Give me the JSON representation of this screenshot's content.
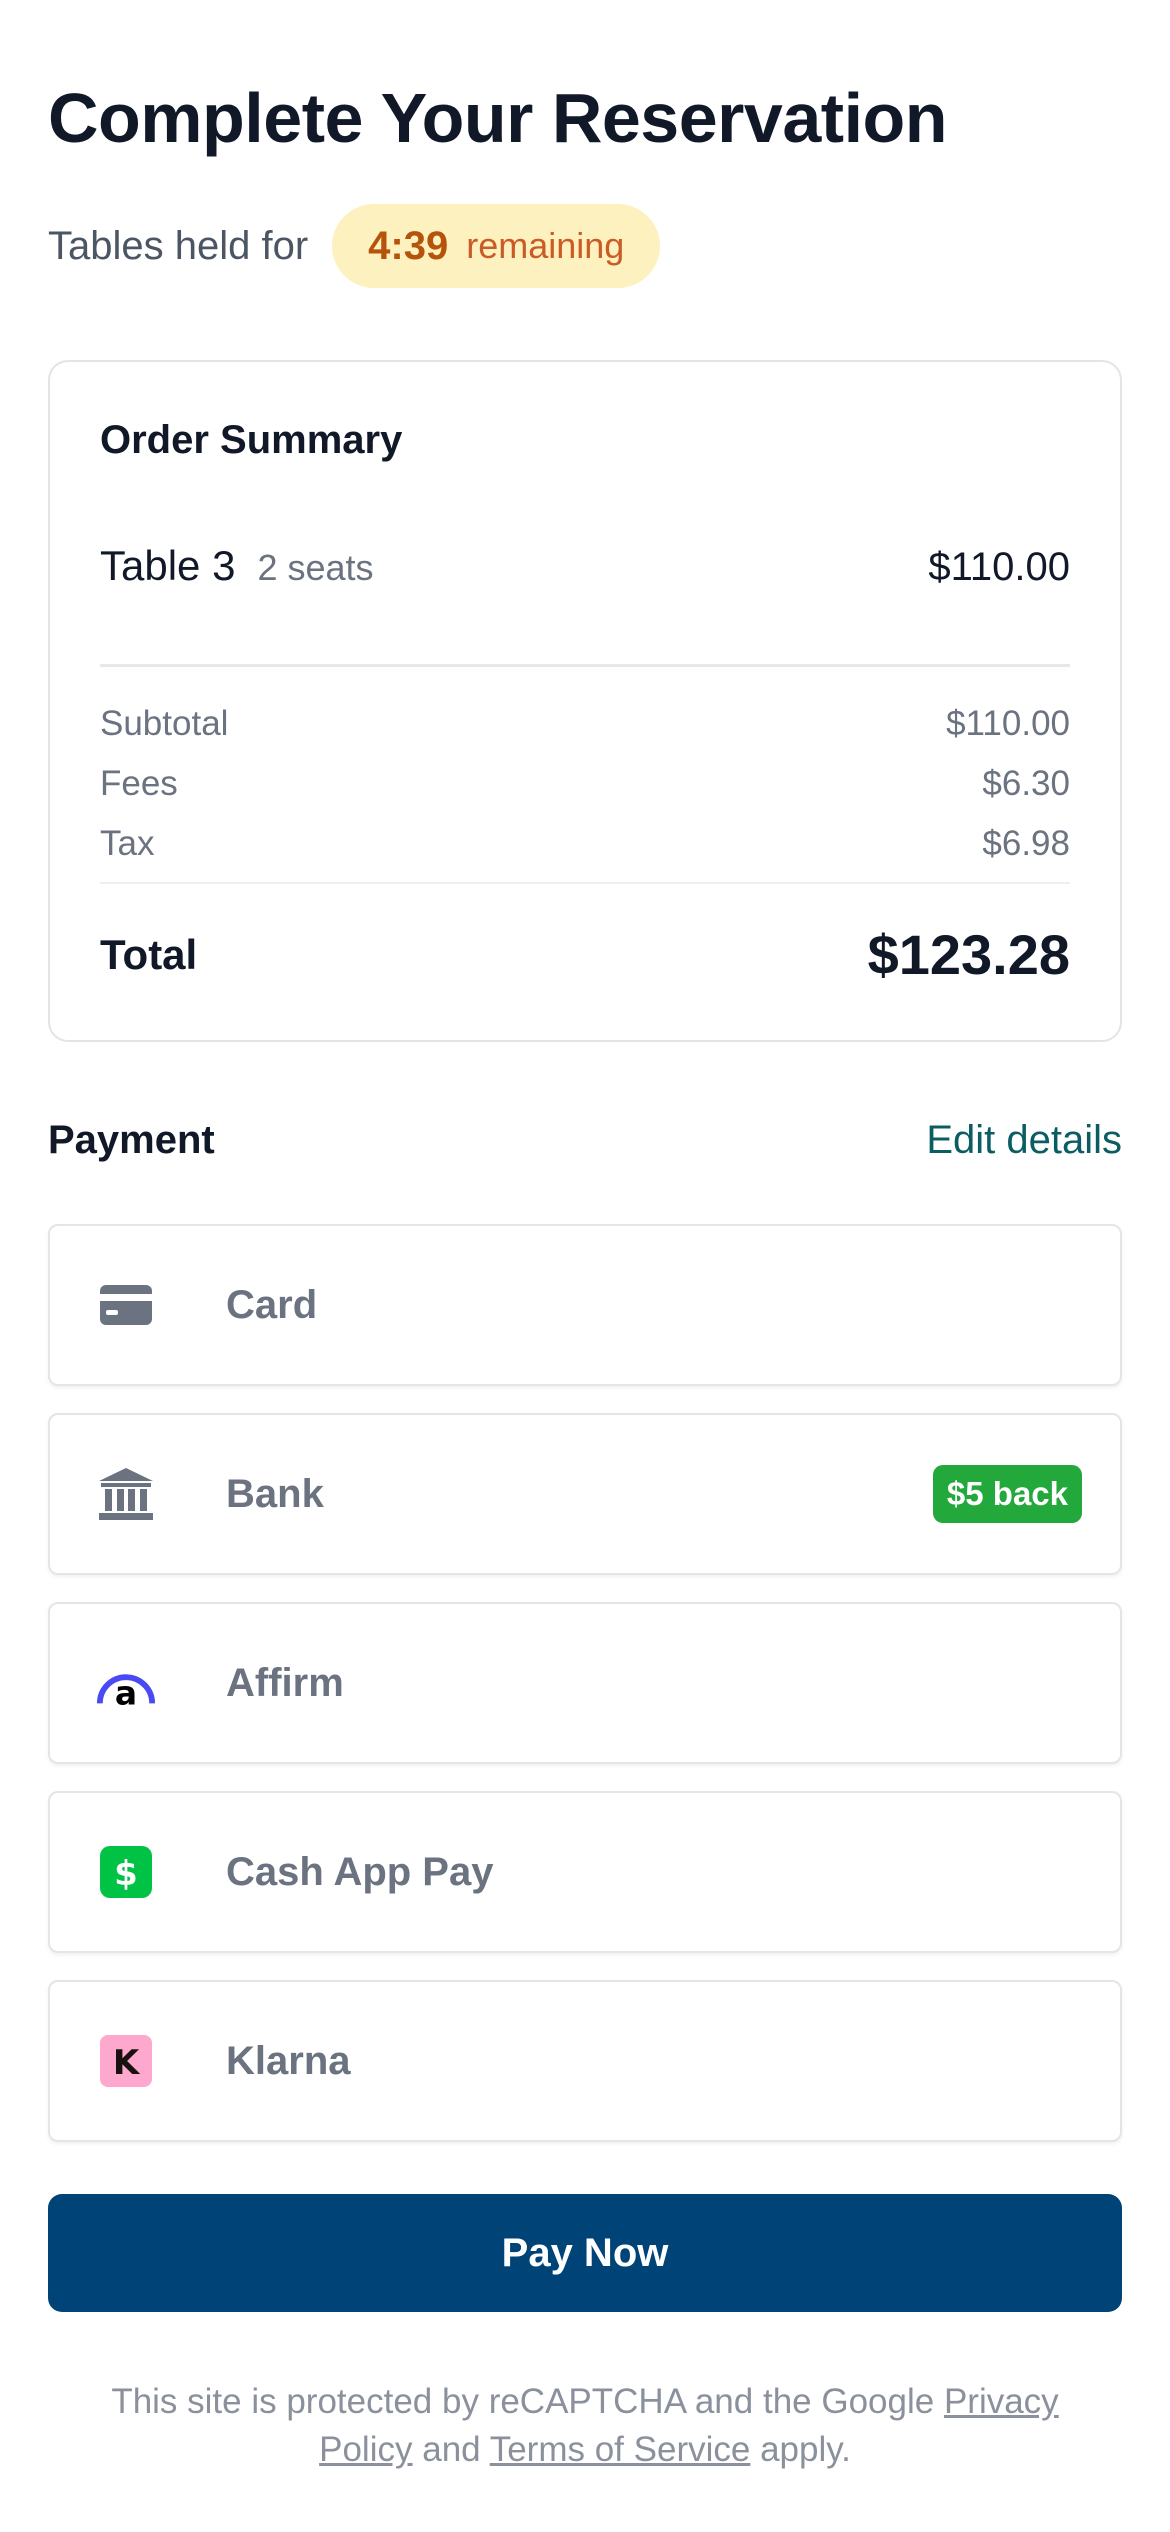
{
  "page": {
    "title": "Complete Your Reservation"
  },
  "timer": {
    "label": "Tables held for",
    "value": "4:39",
    "suffix": "remaining"
  },
  "summary": {
    "title": "Order Summary",
    "item": {
      "name": "Table 3",
      "seats": "2 seats",
      "price": "$110.00"
    },
    "lines": [
      {
        "label": "Subtotal",
        "value": "$110.00"
      },
      {
        "label": "Fees",
        "value": "$6.30"
      },
      {
        "label": "Tax",
        "value": "$6.98"
      }
    ],
    "total": {
      "label": "Total",
      "value": "$123.28"
    }
  },
  "payment": {
    "title": "Payment",
    "edit_label": "Edit details",
    "methods": [
      {
        "label": "Card",
        "icon": "card-icon"
      },
      {
        "label": "Bank",
        "icon": "bank-icon",
        "badge": "$5 back"
      },
      {
        "label": "Affirm",
        "icon": "affirm-icon"
      },
      {
        "label": "Cash App Pay",
        "icon": "cash-app-icon"
      },
      {
        "label": "Klarna",
        "icon": "klarna-icon"
      }
    ]
  },
  "pay_button": {
    "label": "Pay Now"
  },
  "legal": {
    "prefix": "This site is protected by reCAPTCHA and the Google ",
    "privacy_link": "Privacy Policy",
    "middle": " and ",
    "terms_link": "Terms of Service",
    "suffix": " apply."
  },
  "colors": {
    "primary": "#004477",
    "link": "#0b5d63",
    "timer_bg": "#fdf1c0",
    "timer_text": "#b45309",
    "badge_green": "#22a83b"
  }
}
